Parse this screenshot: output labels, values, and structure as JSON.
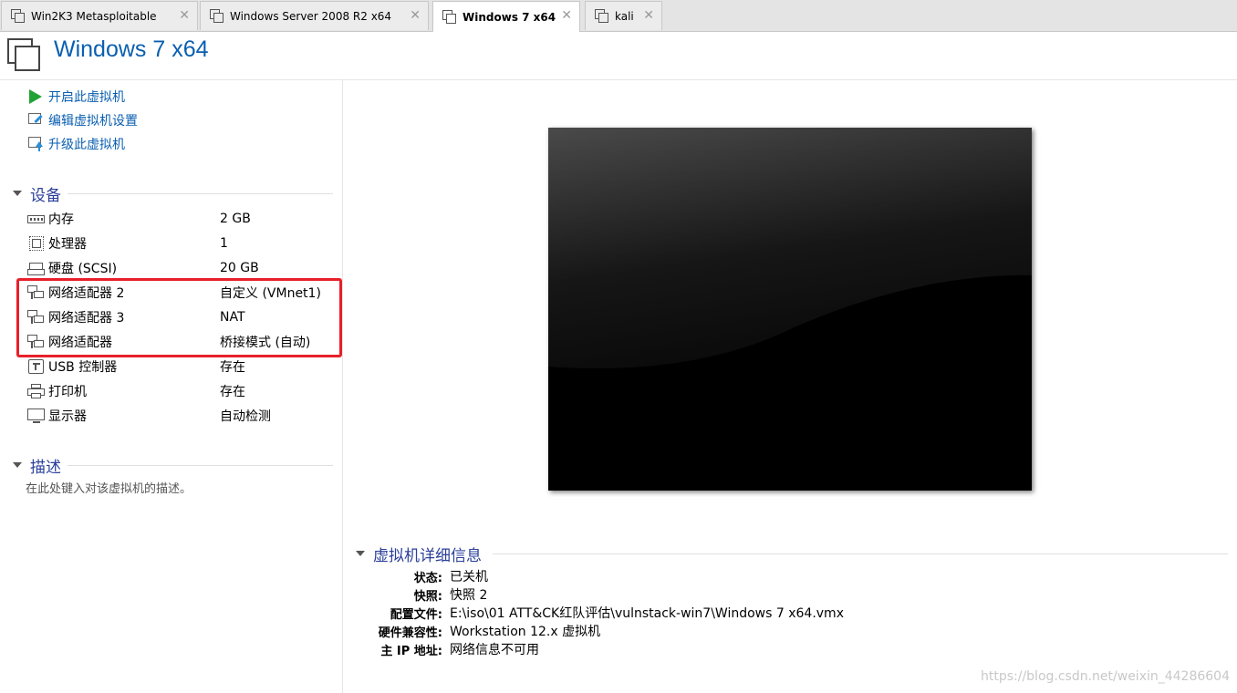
{
  "tabs": [
    {
      "label": "Win2K3 Metasploitable",
      "active": false
    },
    {
      "label": "Windows Server 2008 R2 x64",
      "active": false
    },
    {
      "label": "Windows 7 x64",
      "active": true
    },
    {
      "label": "kali",
      "active": false
    }
  ],
  "tab_close_glyph": "✕",
  "header": {
    "title": "Windows 7 x64"
  },
  "actions": {
    "power_on": "开启此虚拟机",
    "edit_settings": "编辑虚拟机设置",
    "upgrade": "升级此虚拟机"
  },
  "devices": {
    "heading": "设备",
    "items": [
      {
        "name": "内存",
        "value": "2 GB",
        "icon": "memory-icon"
      },
      {
        "name": "处理器",
        "value": "1",
        "icon": "processor-icon"
      },
      {
        "name": "硬盘 (SCSI)",
        "value": "20 GB",
        "icon": "harddisk-icon"
      },
      {
        "name": "网络适配器 2",
        "value": "自定义 (VMnet1)",
        "icon": "network-adapter-icon"
      },
      {
        "name": "网络适配器 3",
        "value": "NAT",
        "icon": "network-adapter-icon"
      },
      {
        "name": "网络适配器",
        "value": "桥接模式 (自动)",
        "icon": "network-adapter-icon"
      },
      {
        "name": "USB 控制器",
        "value": "存在",
        "icon": "usb-icon"
      },
      {
        "name": "打印机",
        "value": "存在",
        "icon": "printer-icon"
      },
      {
        "name": "显示器",
        "value": "自动检测",
        "icon": "display-icon"
      }
    ]
  },
  "description": {
    "heading": "描述",
    "placeholder": "在此处键入对该虚拟机的描述。"
  },
  "details": {
    "heading": "虚拟机详细信息",
    "rows": [
      {
        "key": "状态:",
        "value": "已关机"
      },
      {
        "key": "快照:",
        "value": "快照 2"
      },
      {
        "key": "配置文件:",
        "value": "E:\\iso\\01 ATT&CK红队评估\\vulnstack-win7\\Windows 7 x64.vmx"
      },
      {
        "key": "硬件兼容性:",
        "value": "Workstation 12.x 虚拟机"
      },
      {
        "key": "主 IP 地址:",
        "value": "网络信息不可用"
      }
    ]
  },
  "watermark": "https://blog.csdn.net/weixin_44286604",
  "colors": {
    "link": "#0a5fb0",
    "section": "#2b3f9a",
    "highlight": "#e8202a",
    "power": "#22a234"
  }
}
